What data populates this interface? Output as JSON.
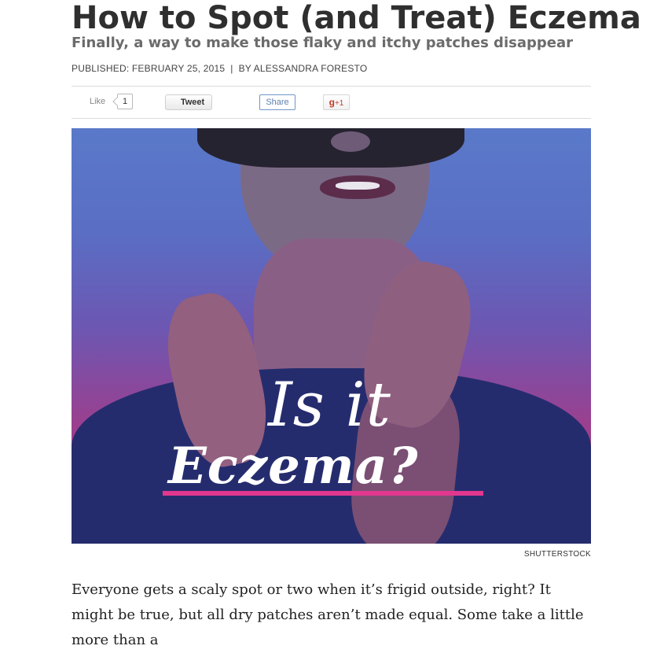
{
  "article": {
    "title": "How to Spot (and Treat) Eczema",
    "subtitle": "Finally, a way to make those flaky and itchy patches disappear",
    "published": "PUBLISHED: FEBRUARY 25, 2015",
    "separator": "|",
    "author": "BY ALESSANDRA FORESTO"
  },
  "social": {
    "like_label": "Like",
    "like_count": "1",
    "tweet_label": "Tweet",
    "share_label": "Share",
    "gplus_g": "g",
    "gplus_plus": "+1"
  },
  "hero": {
    "line1": "Is it",
    "line2": "Eczema?",
    "credit": "SHUTTERSTOCK"
  },
  "body": {
    "paragraph": "Everyone gets a scaly spot or two when it’s frigid outside, right? It might be true, but all dry patches aren’t made equal. Some take a little more than a"
  },
  "colors": {
    "accent_pink": "#e2378f",
    "share_blue": "#6f96c8",
    "gplus_red": "#c23a2b"
  }
}
